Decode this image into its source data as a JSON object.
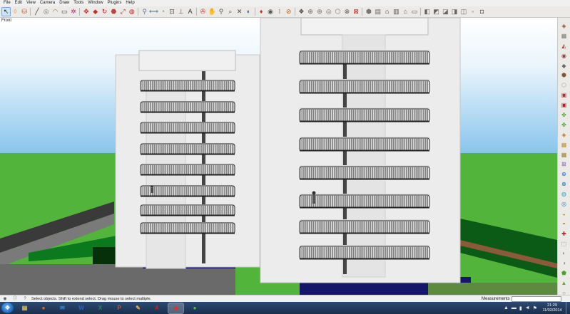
{
  "menu": {
    "items": [
      {
        "id": "file",
        "label": "File"
      },
      {
        "id": "edit",
        "label": "Edit"
      },
      {
        "id": "view",
        "label": "View"
      },
      {
        "id": "camera",
        "label": "Camera"
      },
      {
        "id": "draw",
        "label": "Draw"
      },
      {
        "id": "tools",
        "label": "Tools"
      },
      {
        "id": "window",
        "label": "Window"
      },
      {
        "id": "plugins",
        "label": "Plugins"
      },
      {
        "id": "help",
        "label": "Help"
      }
    ]
  },
  "toolbar": {
    "groups": [
      [
        {
          "name": "select-icon",
          "glyph": "↖",
          "color": "#222",
          "active": true
        },
        {
          "name": "eraser-icon",
          "glyph": "◊",
          "color": "#d0a050"
        },
        {
          "name": "paint-bucket-icon",
          "glyph": "⛁",
          "color": "#d04020"
        }
      ],
      [
        {
          "name": "line-icon",
          "glyph": "╱",
          "color": "#333"
        },
        {
          "name": "circle-icon",
          "glyph": "◎",
          "color": "#777"
        },
        {
          "name": "arc-icon",
          "glyph": "◠",
          "color": "#b06030"
        },
        {
          "name": "rectangle-icon",
          "glyph": "▭",
          "color": "#444"
        },
        {
          "name": "polygon-icon",
          "glyph": "✲",
          "color": "#b03070"
        }
      ],
      [
        {
          "name": "move-icon",
          "glyph": "✥",
          "color": "#c02020"
        },
        {
          "name": "push-pull-icon",
          "glyph": "◆",
          "color": "#c03030"
        },
        {
          "name": "rotate-icon",
          "glyph": "↻",
          "color": "#c02020"
        },
        {
          "name": "follow-me-icon",
          "glyph": "⬣",
          "color": "#c04040"
        },
        {
          "name": "scale-icon",
          "glyph": "⤢",
          "color": "#c02020"
        },
        {
          "name": "offset-icon",
          "glyph": "◍",
          "color": "#c02020"
        }
      ],
      [
        {
          "name": "tape-measure-icon",
          "glyph": "⚲",
          "color": "#6070a0"
        },
        {
          "name": "dimensions-icon",
          "glyph": "⟷",
          "color": "#507090"
        },
        {
          "name": "protractor-icon",
          "glyph": "◔",
          "color": "#50a050"
        },
        {
          "name": "text-icon",
          "glyph": "⊡",
          "color": "#444"
        },
        {
          "name": "axes-icon",
          "glyph": "⊥",
          "color": "#555"
        },
        {
          "name": "3d-text-icon",
          "glyph": "A",
          "color": "#333"
        }
      ],
      [
        {
          "name": "orbit-icon",
          "glyph": "✇",
          "color": "#c03030"
        },
        {
          "name": "pan-icon",
          "glyph": "✋",
          "color": "#c07040"
        },
        {
          "name": "zoom-icon",
          "glyph": "⚲",
          "color": "#555"
        },
        {
          "name": "zoom-window-icon",
          "glyph": "⌕",
          "color": "#555"
        },
        {
          "name": "zoom-extents-icon",
          "glyph": "✕",
          "color": "#444"
        },
        {
          "name": "previous-view-icon",
          "glyph": "◐",
          "color": "#3050a0"
        }
      ],
      [
        {
          "name": "position-camera-icon",
          "glyph": "♦",
          "color": "#c03030"
        },
        {
          "name": "look-around-icon",
          "glyph": "◉",
          "color": "#555"
        },
        {
          "name": "walk-icon",
          "glyph": "⁝",
          "color": "#444"
        },
        {
          "name": "section-plane-icon",
          "glyph": "⊘",
          "color": "#c06000"
        }
      ],
      [
        {
          "name": "get-models-icon",
          "glyph": "❖",
          "color": "#444"
        },
        {
          "name": "share-model-icon",
          "glyph": "⊕",
          "color": "#666"
        },
        {
          "name": "share-component-icon",
          "glyph": "⊛",
          "color": "#666"
        },
        {
          "name": "extension-warehouse-icon",
          "glyph": "◎",
          "color": "#777"
        },
        {
          "name": "component-icon",
          "glyph": "⬡",
          "color": "#777"
        },
        {
          "name": "match-photo-icon",
          "glyph": "⊗",
          "color": "#555"
        },
        {
          "name": "x-ray-icon",
          "glyph": "⊠",
          "color": "#c02020"
        }
      ],
      [
        {
          "name": "iso-view-icon",
          "glyph": "⬢",
          "color": "#777"
        },
        {
          "name": "top-view-icon",
          "glyph": "▤",
          "color": "#666"
        },
        {
          "name": "front-view-icon",
          "glyph": "⌂",
          "color": "#333"
        },
        {
          "name": "right-view-icon",
          "glyph": "▥",
          "color": "#555"
        },
        {
          "name": "back-view-icon",
          "glyph": "⌂",
          "color": "#555"
        },
        {
          "name": "left-view-icon",
          "glyph": "▭",
          "color": "#555"
        }
      ],
      [
        {
          "name": "xray-style-icon",
          "glyph": "◧",
          "color": "#666"
        },
        {
          "name": "wireframe-style-icon",
          "glyph": "◩",
          "color": "#666"
        },
        {
          "name": "hidden-line-style-icon",
          "glyph": "◪",
          "color": "#666"
        },
        {
          "name": "shaded-style-icon",
          "glyph": "◨",
          "color": "#666"
        },
        {
          "name": "shaded-texture-style-icon",
          "glyph": "◫",
          "color": "#666"
        },
        {
          "name": "monochrome-style-icon",
          "glyph": "◦",
          "color": "#666"
        },
        {
          "name": "back-edges-style-icon",
          "glyph": "◘",
          "color": "#666"
        }
      ]
    ]
  },
  "viewport": {
    "view_label": "Front"
  },
  "right_toolbar": {
    "items": [
      {
        "name": "sandbox-from-contours-icon",
        "glyph": "◈",
        "color": "#8a5030"
      },
      {
        "name": "sandbox-from-scratch-icon",
        "glyph": "▦",
        "color": "#7a7a7a"
      },
      {
        "name": "smoove-icon",
        "glyph": "◭",
        "color": "#a04030"
      },
      {
        "name": "stamp-icon",
        "glyph": "◉",
        "color": "#904040"
      },
      {
        "name": "drape-icon",
        "glyph": "◆",
        "color": "#6a6a6a"
      },
      {
        "name": "add-detail-icon",
        "glyph": "⬢",
        "color": "#7a5a3a"
      },
      {
        "name": "flip-edge-icon",
        "glyph": "⬡",
        "color": "#999"
      },
      {
        "name": "plugin-tool-1-icon",
        "glyph": "▣",
        "color": "#b03030"
      },
      {
        "name": "plugin-tool-2-icon",
        "glyph": "▣",
        "color": "#b02020"
      },
      {
        "name": "plugin-tool-3-icon",
        "glyph": "✤",
        "color": "#60a040"
      },
      {
        "name": "plugin-tool-4-icon",
        "glyph": "✤",
        "color": "#50a040"
      },
      {
        "name": "plugin-tool-5-icon",
        "glyph": "◈",
        "color": "#c07030"
      },
      {
        "name": "plugin-tool-6-icon",
        "glyph": "▦",
        "color": "#c09030"
      },
      {
        "name": "plugin-tool-7-icon",
        "glyph": "▦",
        "color": "#a08030"
      },
      {
        "name": "plugin-tool-8-icon",
        "glyph": "⊞",
        "color": "#8060a0"
      },
      {
        "name": "plugin-tool-9-icon",
        "glyph": "⊕",
        "color": "#3070c0"
      },
      {
        "name": "plugin-tool-10-icon",
        "glyph": "⊗",
        "color": "#2070b0"
      },
      {
        "name": "plugin-tool-11-icon",
        "glyph": "◍",
        "color": "#30a0c0"
      },
      {
        "name": "plugin-tool-12-icon",
        "glyph": "◎",
        "color": "#3080c0"
      },
      {
        "name": "plugin-tool-13-icon",
        "glyph": "◒",
        "color": "#c0a020"
      },
      {
        "name": "plugin-tool-14-icon",
        "glyph": "◓",
        "color": "#b08020"
      },
      {
        "name": "plugin-tool-15-icon",
        "glyph": "✚",
        "color": "#a02020"
      },
      {
        "name": "plugin-tool-16-icon",
        "glyph": "⬚",
        "color": "#707070"
      },
      {
        "name": "plugin-tool-17-icon",
        "glyph": "◐",
        "color": "#909090"
      },
      {
        "name": "plugin-tool-18-icon",
        "glyph": "◑",
        "color": "#909090"
      },
      {
        "name": "plugin-tool-19-icon",
        "glyph": "⬟",
        "color": "#50a030"
      },
      {
        "name": "plugin-tool-20-icon",
        "glyph": "▲",
        "color": "#6aa040"
      },
      {
        "name": "plugin-tool-21-icon",
        "glyph": "○",
        "color": "#888"
      },
      {
        "name": "plugin-tool-22-icon",
        "glyph": "◦",
        "color": "#777"
      }
    ]
  },
  "status": {
    "text": "Select objects. Shift to extend select. Drag mouse to select multiple.",
    "measurements_label": "Measurements",
    "measurements_value": ""
  },
  "taskbar": {
    "apps": [
      {
        "name": "explorer-icon",
        "glyph": "▤",
        "color": "#f4c64a",
        "active": false
      },
      {
        "name": "firefox-icon",
        "glyph": "●",
        "color": "#e86b1f",
        "active": false
      },
      {
        "name": "outlook-icon",
        "glyph": "✉",
        "color": "#3b86d6",
        "active": false
      },
      {
        "name": "word-icon",
        "glyph": "W",
        "color": "#2a62c7",
        "active": false
      },
      {
        "name": "excel-icon",
        "glyph": "X",
        "color": "#1f8f3a",
        "active": false
      },
      {
        "name": "powerpoint-icon",
        "glyph": "P",
        "color": "#d2522b",
        "active": false
      },
      {
        "name": "paint-icon",
        "glyph": "✎",
        "color": "#f0b040",
        "active": false
      },
      {
        "name": "acrobat-icon",
        "glyph": "A",
        "color": "#d02020",
        "active": false
      },
      {
        "name": "sketchup-icon",
        "glyph": "◆",
        "color": "#e0302a",
        "active": true
      },
      {
        "name": "spotify-icon",
        "glyph": "●",
        "color": "#4ec04e",
        "active": false
      }
    ],
    "tray_icons": [
      {
        "name": "show-hidden-icons-icon",
        "glyph": "▲"
      },
      {
        "name": "keyboard-icon",
        "glyph": "▬"
      },
      {
        "name": "network-icon",
        "glyph": "▮"
      },
      {
        "name": "volume-icon",
        "glyph": "◄"
      },
      {
        "name": "flag-icon",
        "glyph": "⚑"
      }
    ],
    "time": "21:29",
    "date": "11/02/2014"
  },
  "colors": {
    "sky": "#86c3ec",
    "grass": "#52b43a",
    "building_wall": "#ececec",
    "water": "#15156a"
  }
}
